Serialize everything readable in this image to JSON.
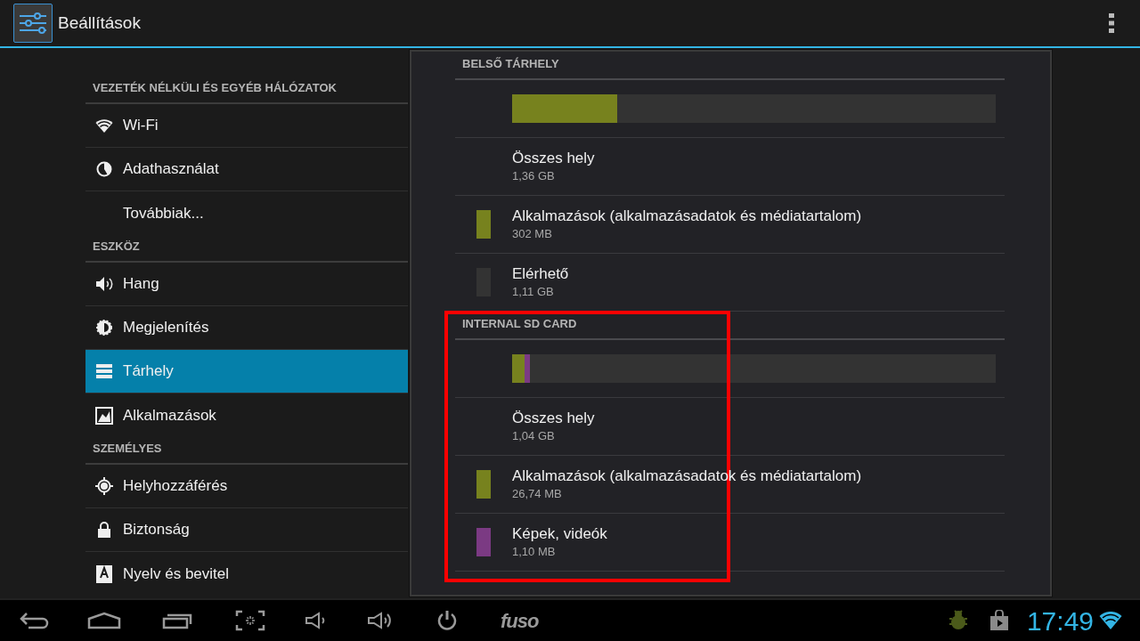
{
  "title_bar": {
    "title": "Beállítások"
  },
  "sidebar": {
    "sections": [
      {
        "header": "VEZETÉK NÉLKÜLI ÉS EGYÉB HÁLÓZATOK",
        "items": [
          {
            "label": "Wi-Fi",
            "selected": false
          },
          {
            "label": "Adathasználat",
            "selected": false
          },
          {
            "label": "Továbbiak...",
            "selected": false
          }
        ]
      },
      {
        "header": "ESZKÖZ",
        "items": [
          {
            "label": "Hang",
            "selected": false
          },
          {
            "label": "Megjelenítés",
            "selected": false
          },
          {
            "label": "Tárhely",
            "selected": true
          },
          {
            "label": "Alkalmazások",
            "selected": false
          }
        ]
      },
      {
        "header": "SZEMÉLYES",
        "items": [
          {
            "label": "Helyhozzáférés",
            "selected": false
          },
          {
            "label": "Biztonság",
            "selected": false
          },
          {
            "label": "Nyelv és bevitel",
            "selected": false
          }
        ]
      }
    ]
  },
  "storage": {
    "sections": [
      {
        "header": "BELSŐ TÁRHELY",
        "usage_bar": [
          {
            "color": "#77821e",
            "level": 0.217
          }
        ],
        "rows": [
          {
            "title": "Összes hely",
            "value": "1,36 GB"
          },
          {
            "title": "Alkalmazások (alkalmazásadatok és médiatartalom)",
            "value": "302 MB",
            "color": "#77821e"
          },
          {
            "title": "Elérhető",
            "value": "1,11 GB",
            "color": "#333333"
          }
        ]
      },
      {
        "header": "INTERNAL SD CARD",
        "usage_bar": [
          {
            "color": "#77821e",
            "level": 0.026
          },
          {
            "color": "#7b3a83",
            "level": 0.011
          }
        ],
        "rows": [
          {
            "title": "Összes hely",
            "value": "1,04 GB"
          },
          {
            "title": "Alkalmazások (alkalmazásadatok és médiatartalom)",
            "value": "26,74 MB",
            "color": "#77821e"
          },
          {
            "title": "Képek, videók",
            "value": "1,10 MB",
            "color": "#7b3a83"
          }
        ]
      }
    ]
  },
  "navigation_bar": {
    "brand": "fuso",
    "clock": "17:49"
  }
}
